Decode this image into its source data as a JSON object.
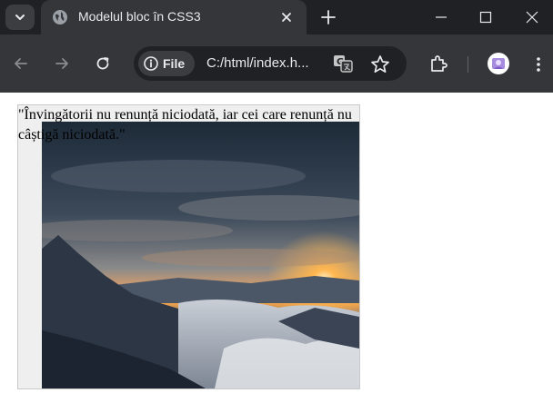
{
  "browser": {
    "tab": {
      "title": "Modelul bloc în CSS3"
    },
    "omnibox": {
      "site_chip": "File",
      "url": "C:/html/index.h..."
    }
  },
  "page": {
    "quote": "\"Învingătorii nu renunță niciodată, iar cei care renunță nu câștigă niciodată.\""
  }
}
